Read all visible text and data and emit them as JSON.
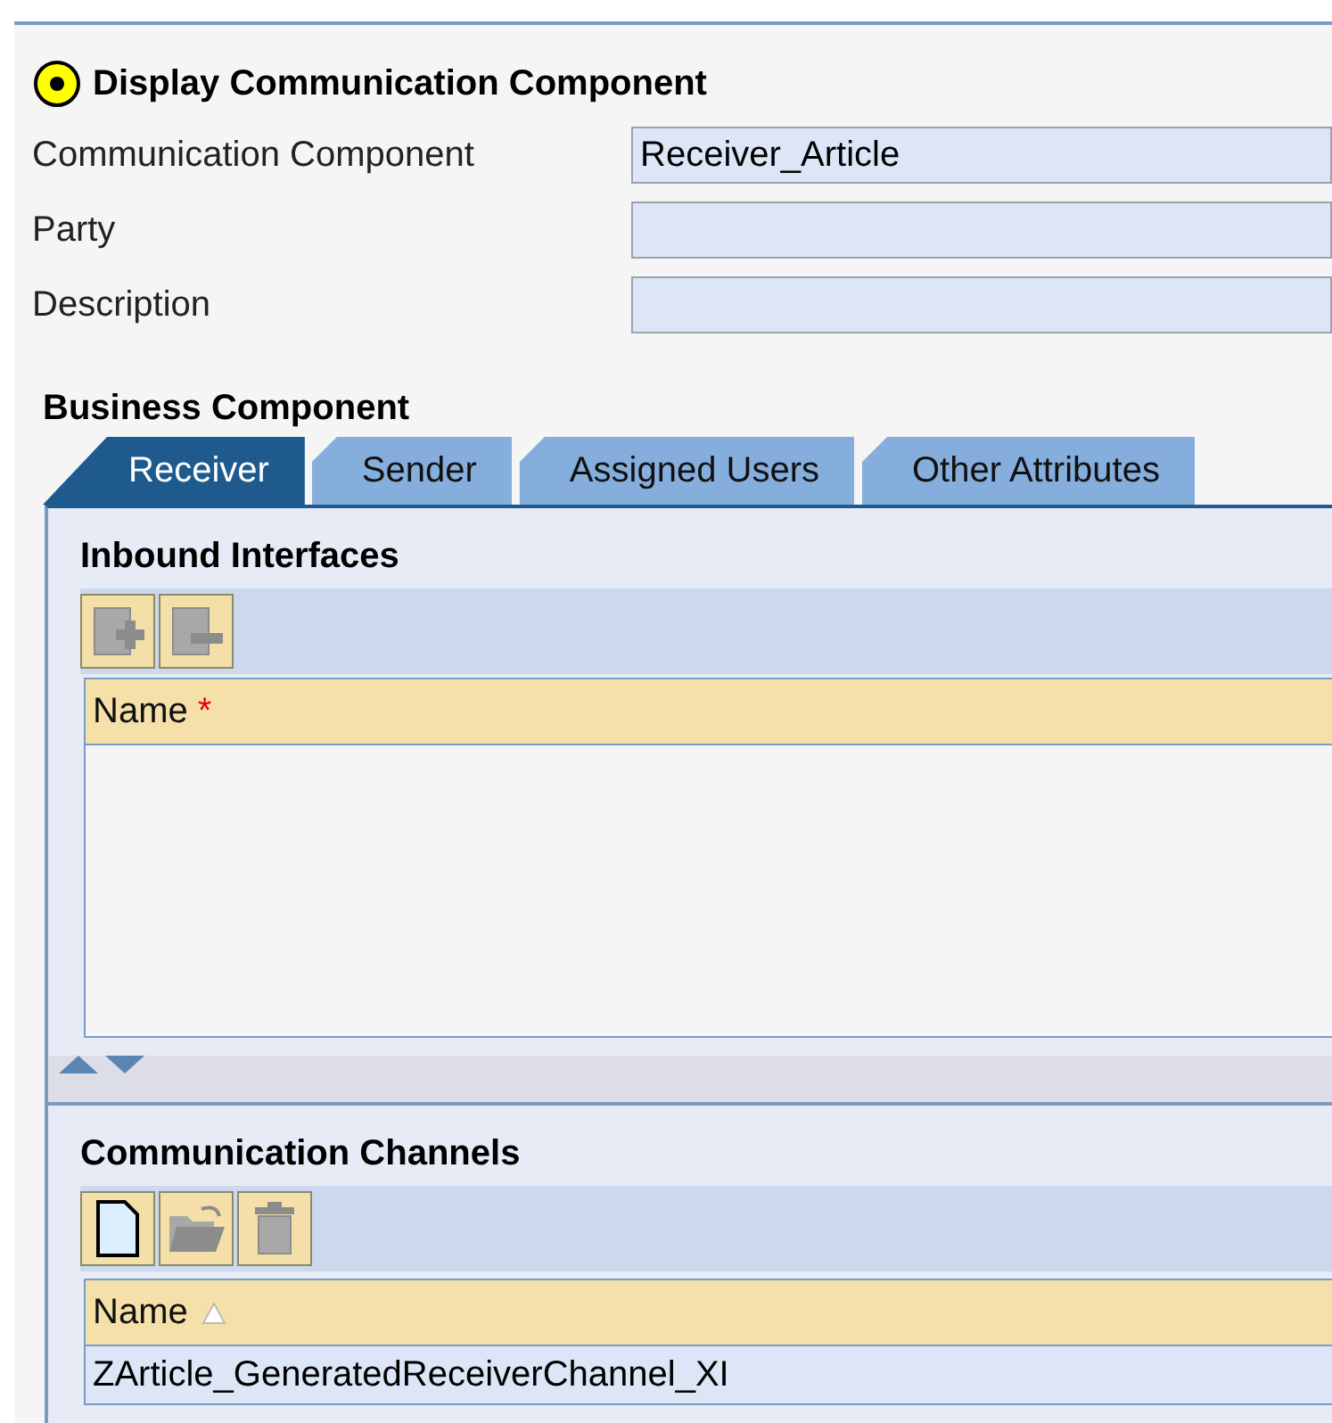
{
  "header": {
    "title": "Display Communication Component"
  },
  "fields": [
    {
      "label": "Communication Component",
      "value": "Receiver_Article"
    },
    {
      "label": "Party"
    },
    {
      "label": "Description"
    }
  ],
  "section_title": "Business Component",
  "tabs": [
    {
      "label": "Receiver",
      "selected": true
    },
    {
      "label": "Sender",
      "selected": false
    },
    {
      "label": "Assigned Users",
      "selected": false
    },
    {
      "label": "Other Attributes",
      "selected": false
    }
  ],
  "inbound": {
    "title": "Inbound Interfaces",
    "tools": [
      {
        "kind": "add-row",
        "disabled": true
      },
      {
        "kind": "remove-row",
        "disabled": true
      }
    ],
    "column": "Name",
    "required_mark": "*"
  },
  "channels": {
    "title": "Communication Channels",
    "tools": [
      {
        "kind": "new",
        "disabled": false
      },
      {
        "kind": "open",
        "disabled": true
      },
      {
        "kind": "delete",
        "disabled": true
      }
    ],
    "column": "Name",
    "rows": [
      "ZArticle_GeneratedReceiverChannel_XI"
    ]
  }
}
